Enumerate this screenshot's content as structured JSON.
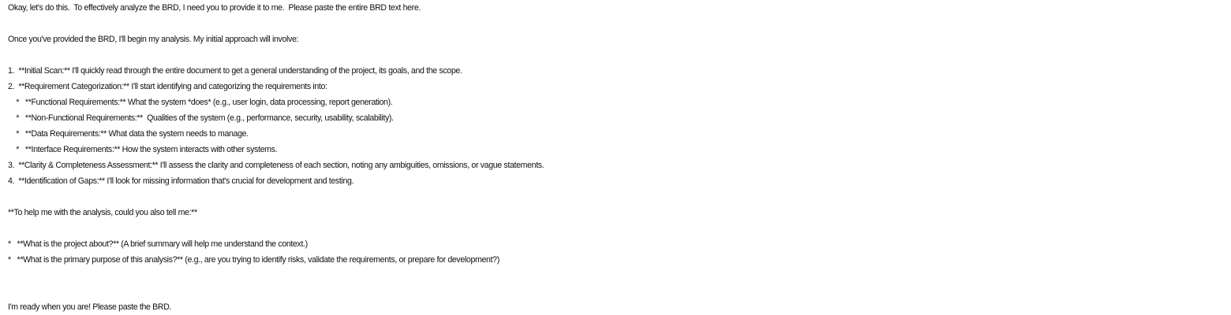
{
  "document": {
    "intro": "Okay, let's do this.  To effectively analyze the BRD, I need you to provide it to me.  Please paste the entire BRD text here.",
    "approach": "Once you've provided the BRD, I'll begin my analysis. My initial approach will involve:",
    "steps": [
      "1.  **Initial Scan:** I'll quickly read through the entire document to get a general understanding of the project, its goals, and the scope.",
      "2.  **Requirement Categorization:** I'll start identifying and categorizing the requirements into:",
      "    *   **Functional Requirements:** What the system *does* (e.g., user login, data processing, report generation).",
      "    *   **Non-Functional Requirements:**  Qualities of the system (e.g., performance, security, usability, scalability).",
      "    *   **Data Requirements:** What data the system needs to manage.",
      "    *   **Interface Requirements:** How the system interacts with other systems.",
      "3.  **Clarity & Completeness Assessment:** I'll assess the clarity and completeness of each section, noting any ambiguities, omissions, or vague statements.",
      "4.  **Identification of Gaps:** I'll look for missing information that's crucial for development and testing."
    ],
    "help_heading": "**To help me with the analysis, could you also tell me:**",
    "questions": [
      "*   **What is the project about?** (A brief summary will help me understand the context.)",
      "*   **What is the primary purpose of this analysis?** (e.g., are you trying to identify risks, validate the requirements, or prepare for development?)"
    ],
    "closing": "I'm ready when you are! Please paste the BRD."
  }
}
